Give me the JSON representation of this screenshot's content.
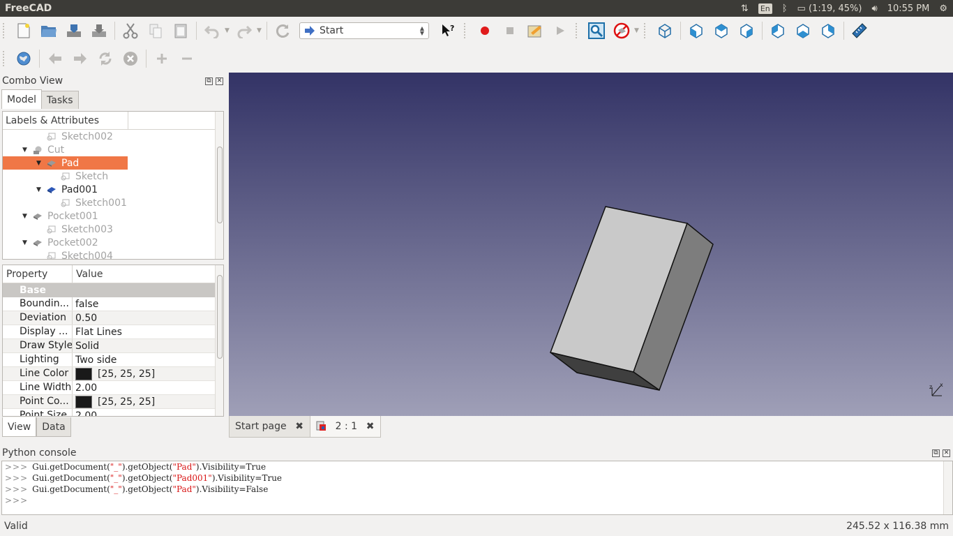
{
  "topbar": {
    "app_title": "FreeCAD",
    "lang": "En",
    "battery": "(1:19, 45%)",
    "clock": "10:55 PM"
  },
  "toolbar": {
    "workbench": "Start"
  },
  "combo": {
    "title": "Combo View",
    "tabs": [
      "Model",
      "Tasks"
    ],
    "tree_header": "Labels & Attributes",
    "tree_items": [
      {
        "label": "Sketch002"
      },
      {
        "label": "Cut"
      },
      {
        "label": "Pad"
      },
      {
        "label": "Sketch"
      },
      {
        "label": "Pad001"
      },
      {
        "label": "Sketch001"
      },
      {
        "label": "Pocket001"
      },
      {
        "label": "Sketch003"
      },
      {
        "label": "Pocket002"
      },
      {
        "label": "Sketch004"
      }
    ],
    "prop_headers": [
      "Property",
      "Value"
    ],
    "group": "Base",
    "properties": [
      {
        "name": "Boundin...",
        "value": "false"
      },
      {
        "name": "Deviation",
        "value": "0.50"
      },
      {
        "name": "Display ...",
        "value": "Flat Lines"
      },
      {
        "name": "Draw Style",
        "value": "Solid"
      },
      {
        "name": "Lighting",
        "value": "Two side"
      },
      {
        "name": "Line Color",
        "value": "[25, 25, 25]"
      },
      {
        "name": "Line Width",
        "value": "2.00"
      },
      {
        "name": "Point Co...",
        "value": "[25, 25, 25]"
      },
      {
        "name": "Point Size",
        "value": "2.00"
      }
    ],
    "bottom_tabs": [
      "View",
      "Data"
    ]
  },
  "doc_tabs": [
    "Start page",
    "2 : 1"
  ],
  "console": {
    "title": "Python console",
    "prompt": ">>>",
    "lines": [
      {
        "a": "Gui.getDocument(",
        "s1": "\"_\"",
        "b": ").getObject(",
        "s2": "\"Pad\"",
        "c": ").Visibility=True"
      },
      {
        "a": "Gui.getDocument(",
        "s1": "\"_\"",
        "b": ").getObject(",
        "s2": "\"Pad001\"",
        "c": ").Visibility=True"
      },
      {
        "a": "Gui.getDocument(",
        "s1": "\"_\"",
        "b": ").getObject(",
        "s2": "\"Pad\"",
        "c": ").Visibility=False"
      }
    ]
  },
  "status": {
    "left": "Valid",
    "right": "245.52 x 116.38 mm"
  },
  "colors": {
    "selection": "#f07746",
    "topbar": "#3c3b37",
    "viewport_top": "#333366",
    "viewport_bottom": "#9f9fb7"
  }
}
